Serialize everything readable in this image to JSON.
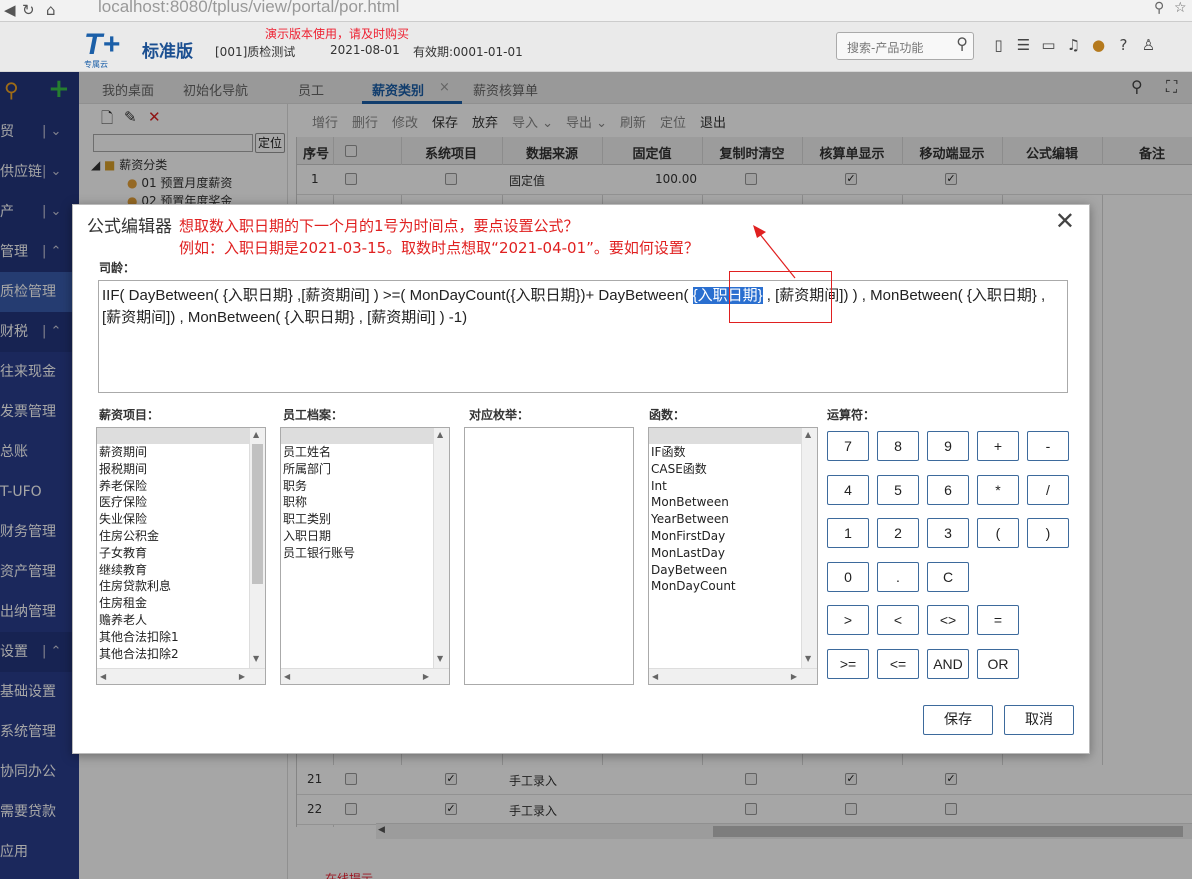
{
  "browser": {
    "url_host": "localhost",
    "url_rest": ":8080/tplus/view/portal/por",
    "url_tail": ".html"
  },
  "header": {
    "logo": "T+",
    "logo_sub": "专属云",
    "edition": "标准版",
    "company": "[001]质检测试",
    "demo_note": "演示版本使用，请及时购买",
    "date": "2021-08-01",
    "validity": "有效期:0001-01-01",
    "search_placeholder": "搜索-产品功能"
  },
  "sidebar": {
    "items": [
      {
        "label": "贸",
        "group": true
      },
      {
        "label": "供应链",
        "group": true
      },
      {
        "label": "产",
        "group": true
      },
      {
        "label": "管理",
        "group": true
      },
      {
        "label": "质检管理",
        "group": false
      },
      {
        "label": "财税",
        "group": true
      },
      {
        "label": "往来现金",
        "group": false
      },
      {
        "label": "发票管理",
        "group": false
      },
      {
        "label": "总账",
        "group": false
      },
      {
        "label": "T-UFO",
        "group": false
      },
      {
        "label": "财务管理",
        "group": false
      },
      {
        "label": "资产管理",
        "group": false
      },
      {
        "label": "出纳管理",
        "group": false
      },
      {
        "label": "设置",
        "group": true
      },
      {
        "label": "基础设置",
        "group": false
      },
      {
        "label": "系统管理",
        "group": false
      },
      {
        "label": "协同办公",
        "group": false
      },
      {
        "label": "需要贷款",
        "group": false
      },
      {
        "label": "应用",
        "group": false
      }
    ]
  },
  "tabs": [
    {
      "label": "我的桌面"
    },
    {
      "label": "初始化导航"
    },
    {
      "label": "员工"
    },
    {
      "label": "薪资类别",
      "active": true
    },
    {
      "label": "薪资核算单"
    }
  ],
  "tree": {
    "locate_label": "定位",
    "root": "薪资分类",
    "nodes": [
      "01 预置月度薪资",
      "02 预置年度奖金"
    ]
  },
  "toolbar": [
    "增行",
    "删行",
    "修改",
    "保存",
    "放弃",
    "导入",
    "导出",
    "刷新",
    "定位",
    "退出"
  ],
  "grid": {
    "headers": [
      "序号",
      "",
      "系统项目",
      "数据来源",
      "固定值",
      "复制时清空",
      "核算单显示",
      "移动端显示",
      "公式编辑",
      "备注"
    ],
    "rows": [
      {
        "no": "1",
        "source": "固定值",
        "value": "100.00",
        "sys": false,
        "clear": false,
        "show": true,
        "mobile": true
      },
      {
        "no": "21",
        "source": "手工录入",
        "value": "",
        "sys": true,
        "clear": false,
        "show": true,
        "mobile": true
      },
      {
        "no": "22",
        "source": "手工录入",
        "value": "",
        "sys": true,
        "clear": false,
        "show": false,
        "mobile": false
      }
    ],
    "bottom_note": "在线提示"
  },
  "modal": {
    "title": "公式编辑器",
    "annotation_line1": "想取数入职日期的下一个月的1号为时间点，要点设置公式？",
    "annotation_line2": "例如：入职日期是2021-03-15。取数时点想取“2021-04-01”。要如何设置？",
    "field_label": "司龄：",
    "formula_part1": "IIF(  DayBetween( {入职日期} ,[薪资期间]  )  >=( MonDayCount({入职日期})+ DayBetween( ",
    "formula_selected": "{入职日期}",
    "formula_part2": " , [薪资期间]) ) , MonBetween( {入职日期} , [薪资期间]) ,   MonBetween( {入职日期} , [薪资期间] ) -1)",
    "lists": {
      "salary": {
        "label": "薪资项目：",
        "items": [
          "薪资期间",
          "报税期间",
          "养老保险",
          "医疗保险",
          "失业保险",
          "住房公积金",
          "子女教育",
          "继续教育",
          "住房贷款利息",
          "住房租金",
          "赡养老人",
          "其他合法扣除1",
          "其他合法扣除2"
        ]
      },
      "employee": {
        "label": "员工档案：",
        "items": [
          "员工姓名",
          "所属部门",
          "职务",
          "职称",
          "职工类别",
          "入职日期",
          "员工银行账号"
        ]
      },
      "enum": {
        "label": "对应枚举：",
        "items": []
      },
      "functions": {
        "label": "函数：",
        "items": [
          "IF函数",
          "CASE函数",
          "Int",
          "MonBetween",
          "YearBetween",
          "MonFirstDay",
          "MonLastDay",
          "DayBetween",
          "MonDayCount"
        ]
      }
    },
    "operators_label": "运算符：",
    "operators": [
      [
        "7",
        "8",
        "9",
        "+",
        "-"
      ],
      [
        "4",
        "5",
        "6",
        "*",
        "/"
      ],
      [
        "1",
        "2",
        "3",
        "(",
        ")"
      ],
      [
        "0",
        ".",
        "C"
      ],
      [
        ">",
        "<",
        "<>",
        "="
      ],
      [
        ">=",
        "<=",
        "AND",
        "OR"
      ]
    ],
    "save_label": "保存",
    "cancel_label": "取消"
  }
}
